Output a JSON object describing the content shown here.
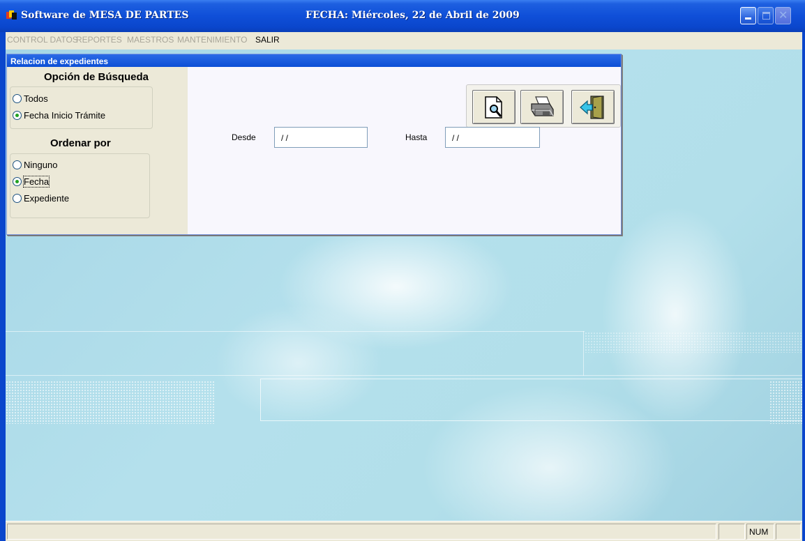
{
  "window": {
    "title": "Software de MESA DE PARTES",
    "date_caption": "FECHA: Miércoles, 22 de Abril de 2009"
  },
  "menu": {
    "items": [
      {
        "label": "CONTROL DATOS",
        "enabled": false
      },
      {
        "label": "REPORTES",
        "enabled": false
      },
      {
        "label": "MAESTROS",
        "enabled": false
      },
      {
        "label": "MANTENIMIENTO",
        "enabled": false
      },
      {
        "label": "SALIR",
        "enabled": true
      }
    ]
  },
  "dialog": {
    "title": "Relacion de expedientes",
    "search_option": {
      "heading": "Opción de Búsqueda",
      "options": [
        {
          "label": "Todos",
          "selected": false
        },
        {
          "label": "Fecha Inicio Trámite",
          "selected": true
        }
      ]
    },
    "order_by": {
      "heading": "Ordenar por",
      "options": [
        {
          "label": "Ninguno",
          "selected": false
        },
        {
          "label": "Fecha",
          "selected": true
        },
        {
          "label": "Expediente",
          "selected": false
        }
      ]
    },
    "range": {
      "from_label": "Desde",
      "from_value": " / /",
      "to_label": "Hasta",
      "to_value": " / /"
    },
    "toolbar": {
      "preview_icon": "print-preview-icon",
      "print_icon": "printer-icon",
      "exit_icon": "exit-door-icon"
    }
  },
  "statusbar": {
    "num_indicator": "NUM"
  },
  "colors": {
    "title_bar": "#0f4fd8",
    "dialog_title": "#1858dc",
    "form_bg": "#ece9d8",
    "panel_bg": "#f8f7fd",
    "workspace": "#b0dce9",
    "radio_checked": "#21a121"
  }
}
